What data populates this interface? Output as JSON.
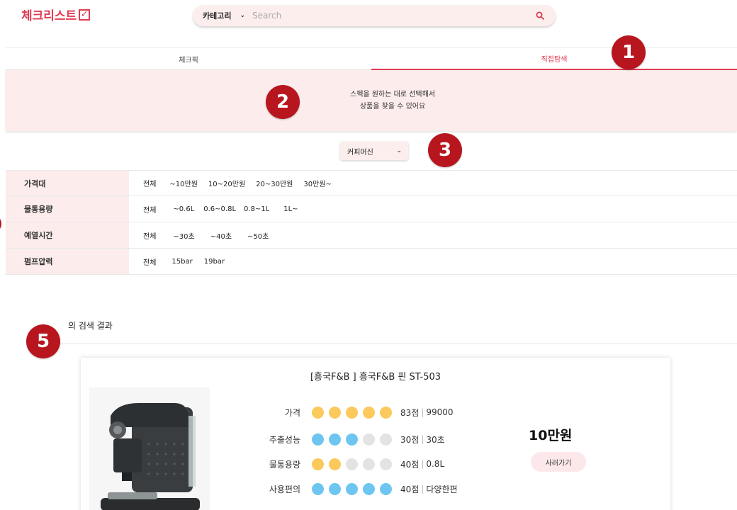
{
  "header": {
    "logo_text": "체크리스트",
    "search": {
      "category_label": "카테고리",
      "placeholder": "Search"
    }
  },
  "tabs": [
    {
      "label": "체크픽",
      "active": false
    },
    {
      "label": "직접탐색",
      "active": true
    }
  ],
  "banner": {
    "line1": "스펙을 원하는 대로 선택해서",
    "line2": "상품을 찾을 수 있어요"
  },
  "product_type": {
    "selected": "커피머신"
  },
  "filters": [
    {
      "label": "가격대",
      "options": [
        "전체",
        "~10만원",
        "10~20만원",
        "20~30만원",
        "30만원~"
      ]
    },
    {
      "label": "물통용량",
      "options": [
        "전체",
        "~0.6L",
        "0.6~0.8L",
        "0.8~1L",
        "1L~"
      ]
    },
    {
      "label": "예열시간",
      "options": [
        "전체",
        "~30초",
        "~40초",
        "~50초"
      ]
    },
    {
      "label": "펌프압력",
      "options": [
        "전체",
        "15bar",
        "19bar"
      ]
    }
  ],
  "results": {
    "title": "의 검색 결과"
  },
  "product": {
    "title": "[흥국F&B ] 흥국F&B 핀 ST-503",
    "price": "10만원",
    "buy_label": "사러가기",
    "specs": [
      {
        "label": "가격",
        "filled": 5,
        "color": "#fbc95c",
        "score": "83점",
        "value": "99000"
      },
      {
        "label": "추출성능",
        "filled": 3,
        "color": "#6ec6f0",
        "score": "30점",
        "value": "30초"
      },
      {
        "label": "물통용량",
        "filled": 2,
        "color": "#fbc95c",
        "score": "40점",
        "value": "0.8L"
      },
      {
        "label": "사용편의",
        "filled": 5,
        "color": "#6ec6f0",
        "score": "40점",
        "value": "다양한편"
      }
    ]
  },
  "markers": [
    "1",
    "2",
    "3",
    "5"
  ],
  "colors": {
    "accent": "#e23b52",
    "marker": "#b8161f",
    "soft_pink": "#fcecec"
  }
}
